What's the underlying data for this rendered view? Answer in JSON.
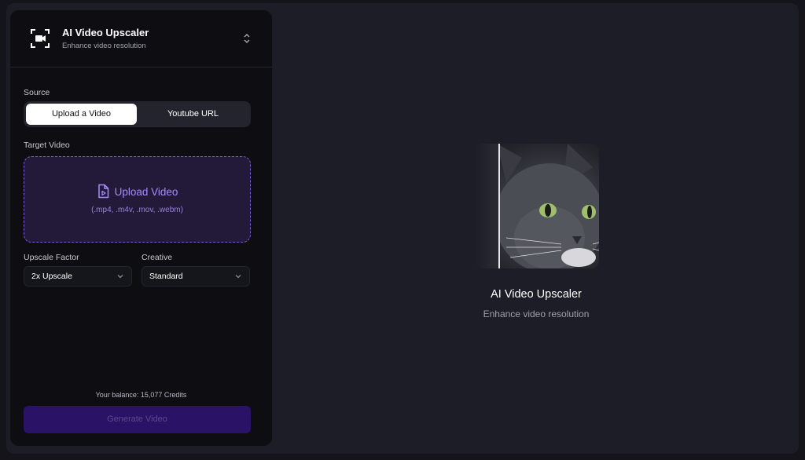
{
  "tool": {
    "title": "AI Video Upscaler",
    "subtitle": "Enhance video resolution",
    "icon": "expand-video-icon"
  },
  "source": {
    "label": "Source",
    "tabs": [
      {
        "label": "Upload a Video",
        "active": true
      },
      {
        "label": "Youtube URL",
        "active": false
      }
    ]
  },
  "target": {
    "label": "Target Video",
    "upload_label": "Upload Video",
    "upload_hint": "(.mp4, .m4v, .mov, .webm)"
  },
  "upscale": {
    "label": "Upscale Factor",
    "value": "2x Upscale"
  },
  "creative": {
    "label": "Creative",
    "value": "Standard"
  },
  "footer": {
    "balance": "Your balance: 15,077 Credits",
    "generate_label": "Generate Video"
  },
  "preview": {
    "title": "AI Video Upscaler",
    "subtitle": "Enhance video resolution"
  },
  "colors": {
    "accent": "#7a5cd6",
    "background": "#1d1d28",
    "panel": "#0d0d12",
    "button_disabled": "#2a1266"
  }
}
